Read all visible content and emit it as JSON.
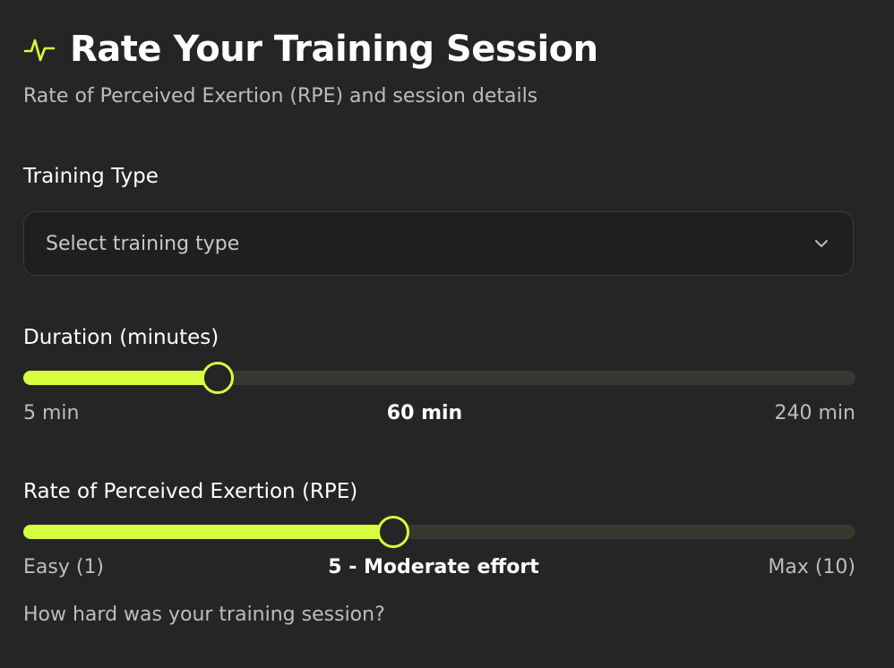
{
  "header": {
    "title": "Rate Your Training Session",
    "subtitle": "Rate of Perceived Exertion (RPE) and session details",
    "icon": "activity-pulse-icon",
    "accent_color": "#d6ff3e"
  },
  "training_type": {
    "label": "Training Type",
    "placeholder": "Select training type",
    "selected": ""
  },
  "duration": {
    "label": "Duration (minutes)",
    "min_label": "5 min",
    "max_label": "240 min",
    "value_label": "60 min",
    "min": 5,
    "max": 240,
    "value": 60
  },
  "rpe": {
    "label": "Rate of Perceived Exertion (RPE)",
    "min_label": "Easy (1)",
    "max_label": "Max (10)",
    "value_label": "5 - Moderate effort",
    "min": 1,
    "max": 10,
    "value": 5,
    "help_text": "How hard was your training session?"
  }
}
